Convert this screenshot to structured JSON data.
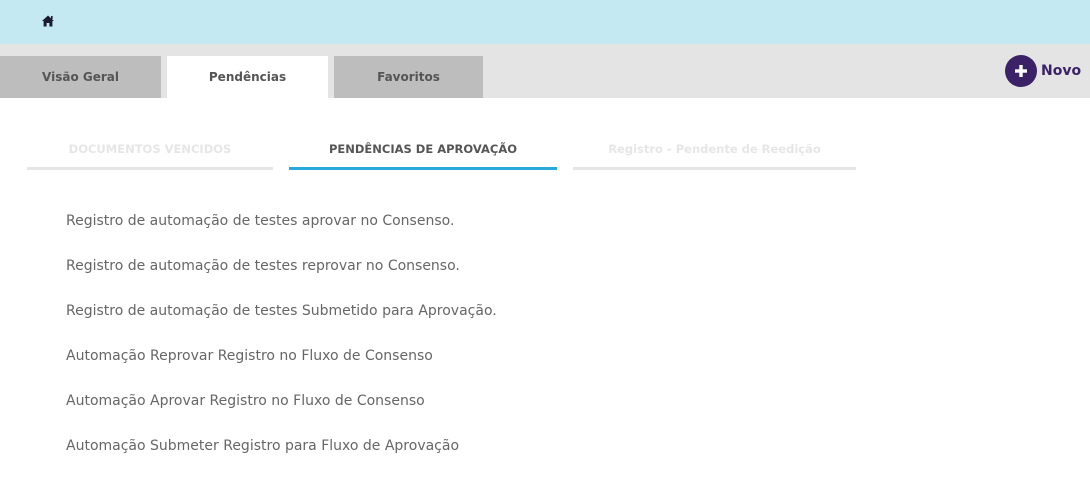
{
  "header": {
    "home_icon": "home-icon"
  },
  "tabs": [
    {
      "label": "Visão Geral",
      "active": false
    },
    {
      "label": "Pendências",
      "active": true
    },
    {
      "label": "Favoritos",
      "active": false
    }
  ],
  "new_button": {
    "icon": "plus-icon",
    "label": "Novo",
    "color": "#3b2166"
  },
  "subtabs": [
    {
      "label": "DOCUMENTOS VENCIDOS",
      "active": false
    },
    {
      "label": "PENDÊNCIAS DE APROVAÇÃO",
      "active": true
    },
    {
      "label": "Registro - Pendente de Reedição",
      "active": false
    }
  ],
  "colors": {
    "topbar": "#c5e9f3",
    "accent": "#29a9d9",
    "tab_inactive": "#bdbdbd"
  },
  "pending_items": [
    "Registro de automação de testes aprovar no Consenso.",
    "Registro de automação de testes reprovar no Consenso.",
    "Registro de automação de testes Submetido para Aprovação.",
    "Automação Reprovar Registro no Fluxo de Consenso",
    "Automação Aprovar Registro no Fluxo de Consenso",
    "Automação Submeter Registro para Fluxo de Aprovação"
  ]
}
